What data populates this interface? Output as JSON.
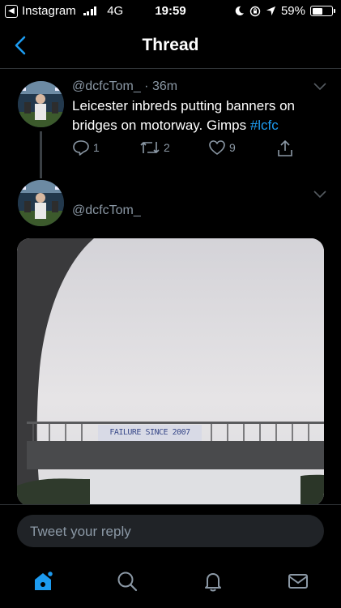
{
  "status_bar": {
    "carrier_back": "Instagram",
    "network": "4G",
    "time": "19:59",
    "battery": "59%",
    "battery_level": 0.59
  },
  "nav": {
    "title": "Thread",
    "back_icon": "chevron-left-icon"
  },
  "tweets": [
    {
      "handle": "@dcfcTom_",
      "time": " · 36m",
      "text": "Leicester inbreds putting banners on bridges on motorway. Gimps ",
      "hashtag": "#lcfc",
      "reply_count": "1",
      "retweet_count": "2",
      "like_count": "9"
    },
    {
      "handle": "@dcfcTom_"
    }
  ],
  "photo": {
    "banner_text": "FAILURE SINCE 2007"
  },
  "reply_box": {
    "placeholder": "Tweet your reply"
  },
  "tabs": [
    "home-icon",
    "search-icon",
    "notifications-icon",
    "messages-icon"
  ],
  "colors": {
    "accent": "#1d9bf0",
    "muted": "#8b98a5",
    "background": "#000000"
  }
}
